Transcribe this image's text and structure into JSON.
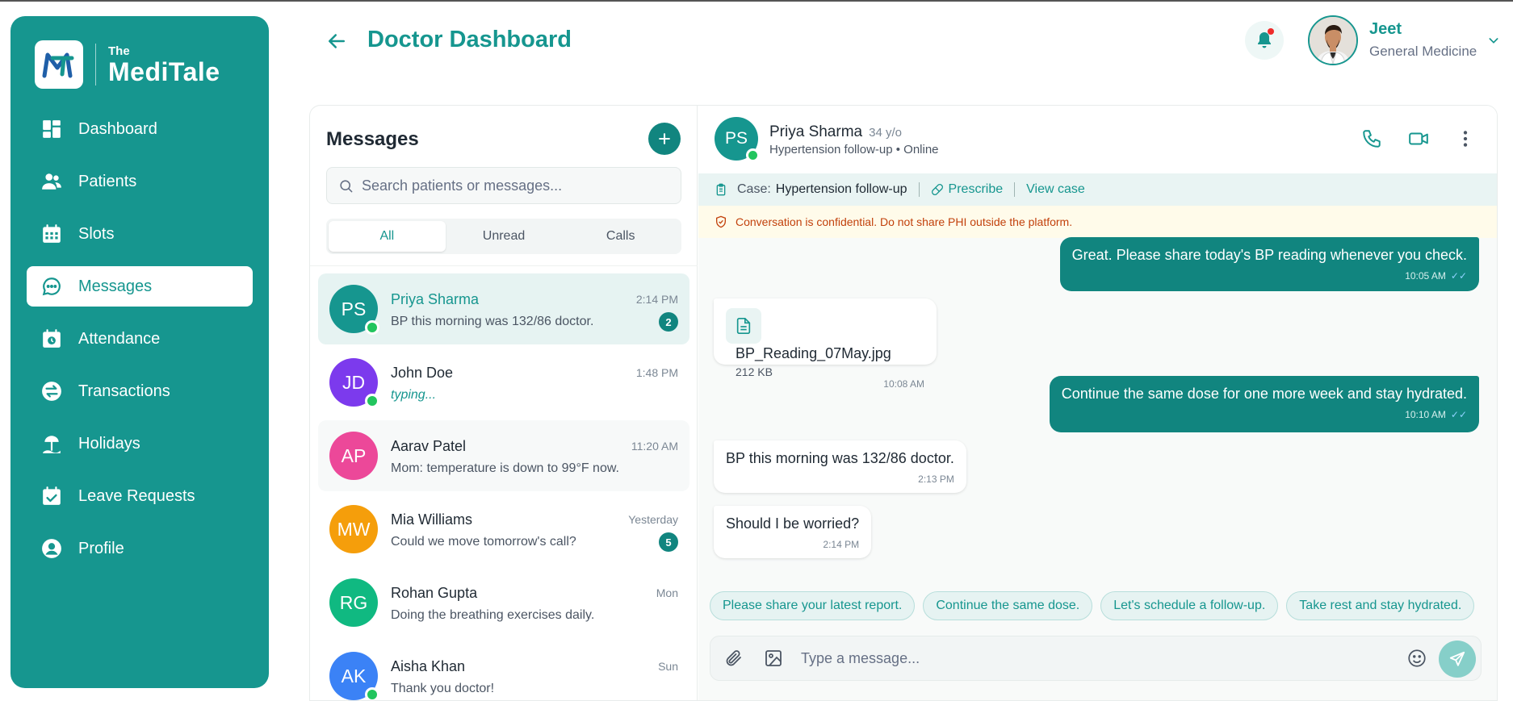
{
  "brand": {
    "prefix": "The",
    "name": "MediTale"
  },
  "nav": {
    "items": [
      {
        "label": "Dashboard",
        "icon": "dashboard-icon"
      },
      {
        "label": "Patients",
        "icon": "patients-icon"
      },
      {
        "label": "Slots",
        "icon": "calendar-icon"
      },
      {
        "label": "Messages",
        "icon": "chat-icon",
        "active": true
      },
      {
        "label": "Attendance",
        "icon": "attendance-icon"
      },
      {
        "label": "Transactions",
        "icon": "transactions-icon"
      },
      {
        "label": "Holidays",
        "icon": "holidays-icon"
      },
      {
        "label": "Leave Requests",
        "icon": "leave-icon"
      },
      {
        "label": "Profile",
        "icon": "profile-icon"
      }
    ]
  },
  "header": {
    "title": "Doctor Dashboard",
    "user": {
      "name": "Jeet",
      "role": "General Medicine"
    }
  },
  "messages": {
    "title": "Messages",
    "search_placeholder": "Search patients or messages...",
    "tabs": [
      "All",
      "Unread",
      "Calls"
    ],
    "active_tab": "All",
    "conversations": [
      {
        "initials": "PS",
        "name": "Priya Sharma",
        "preview": "BP this morning was 132/86 doctor.",
        "time": "2:14 PM",
        "unread": "2",
        "online": true,
        "color": "#16968f",
        "active": true
      },
      {
        "initials": "JD",
        "name": "John Doe",
        "preview": "typing...",
        "time": "1:48 PM",
        "online": true,
        "color": "#7c3aed",
        "typing": true
      },
      {
        "initials": "AP",
        "name": "Aarav Patel",
        "preview": "Mom: temperature is down to 99°F now.",
        "time": "11:20 AM",
        "color": "#ec4899"
      },
      {
        "initials": "MW",
        "name": "Mia Williams",
        "preview": "Could we move tomorrow's call?",
        "time": "Yesterday",
        "unread": "5",
        "color": "#f59e0b"
      },
      {
        "initials": "RG",
        "name": "Rohan Gupta",
        "preview": "Doing the breathing exercises daily.",
        "time": "Mon",
        "color": "#10b981"
      },
      {
        "initials": "AK",
        "name": "Aisha Khan",
        "preview": "Thank you doctor!",
        "time": "Sun",
        "online": true,
        "color": "#3b82f6"
      }
    ]
  },
  "chat": {
    "patient": {
      "initials": "PS",
      "name": "Priya Sharma",
      "age": "34 y/o",
      "subtitle": "Hypertension follow-up • Online"
    },
    "case": {
      "label": "Case:",
      "value": "Hypertension follow-up",
      "prescribe": "Prescribe",
      "view": "View case"
    },
    "confidential": "Conversation is confidential. Do not share PHI outside the platform.",
    "bubbles": {
      "m1": {
        "text": "Great. Please share today's BP reading whenever you check.",
        "time": "10:05 AM"
      },
      "m2": {
        "file_name": "BP_Reading_07May.jpg",
        "file_size": "212 KB",
        "time": "10:08 AM"
      },
      "m3": {
        "text": "Continue the same dose for one more week and stay hydrated.",
        "time": "10:10 AM"
      },
      "m4": {
        "text": "BP this morning was 132/86 doctor.",
        "time": "2:13 PM"
      },
      "m5": {
        "text": "Should I be worried?",
        "time": "2:14 PM"
      }
    },
    "quick_replies": [
      "Please share your latest report.",
      "Continue the same dose.",
      "Let's schedule a follow-up.",
      "Take rest and stay hydrated."
    ],
    "composer_placeholder": "Type a message..."
  },
  "colors": {
    "brand": "#16968f",
    "brand_dark": "#11857f",
    "online": "#22c55e",
    "warning_text": "#c2410c",
    "notification": "#ef2b2b"
  }
}
